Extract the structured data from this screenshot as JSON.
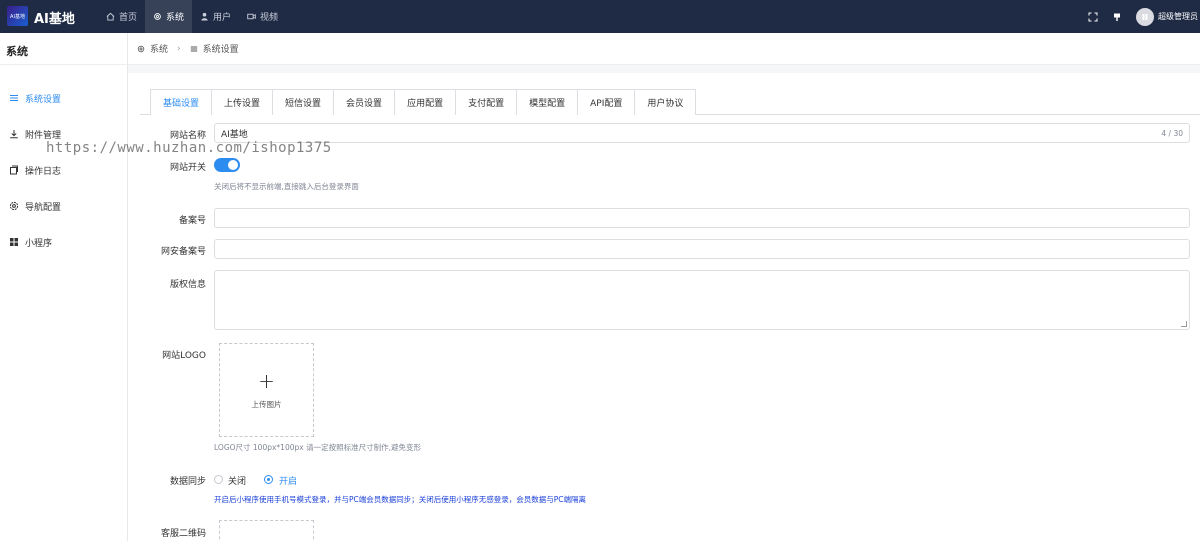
{
  "header": {
    "logo_text": "AI基地",
    "app_title": "AI基地",
    "nav": [
      {
        "label": "首页",
        "icon": "home-icon"
      },
      {
        "label": "系统",
        "icon": "gear-icon"
      },
      {
        "label": "用户",
        "icon": "user-icon"
      },
      {
        "label": "视频",
        "icon": "video-icon"
      }
    ],
    "active_nav": "系统",
    "user_name": "超级管理员"
  },
  "sidebar": {
    "title": "系统",
    "items": [
      {
        "label": "系统设置",
        "icon": "menu-icon",
        "active": true
      },
      {
        "label": "附件管理",
        "icon": "download-icon"
      },
      {
        "label": "操作日志",
        "icon": "copy-icon"
      },
      {
        "label": "导航配置",
        "icon": "gear-icon"
      },
      {
        "label": "小程序",
        "icon": "grid-icon"
      }
    ]
  },
  "breadcrumb": {
    "root": "系统",
    "current": "系统设置"
  },
  "tabs": [
    "基础设置",
    "上传设置",
    "短信设置",
    "会员设置",
    "应用配置",
    "支付配置",
    "模型配置",
    "API配置",
    "用户协议"
  ],
  "active_tab": "基础设置",
  "form": {
    "site_name": {
      "label": "网站名称",
      "value": "AI基地",
      "counter": "4 / 30"
    },
    "site_switch": {
      "label": "网站开关",
      "on": true,
      "hint": "关闭后将不显示前端,直接跳入后台登录界面"
    },
    "icp": {
      "label": "备案号",
      "value": ""
    },
    "police_icp": {
      "label": "网安备案号",
      "value": ""
    },
    "copyright": {
      "label": "版权信息",
      "value": ""
    },
    "logo": {
      "label": "网站LOGO",
      "upload_text": "上传图片",
      "hint": "LOGO尺寸 100px*100px 请一定按照标准尺寸制作,避免变形"
    },
    "data_sync": {
      "label": "数据同步",
      "options": [
        "关闭",
        "开启"
      ],
      "selected": "开启",
      "hint": "开启后小程序使用手机号模式登录，并与PC端会员数据同步；关闭后使用小程序无感登录，会员数据与PC端隔离"
    },
    "service_qr": {
      "label": "客服二维码"
    }
  },
  "watermark": "https://www.huzhan.com/ishop1375",
  "colors": {
    "topbar": "#1f2a44",
    "accent": "#2d8cf0",
    "hint_blue": "#1a3fd8"
  }
}
